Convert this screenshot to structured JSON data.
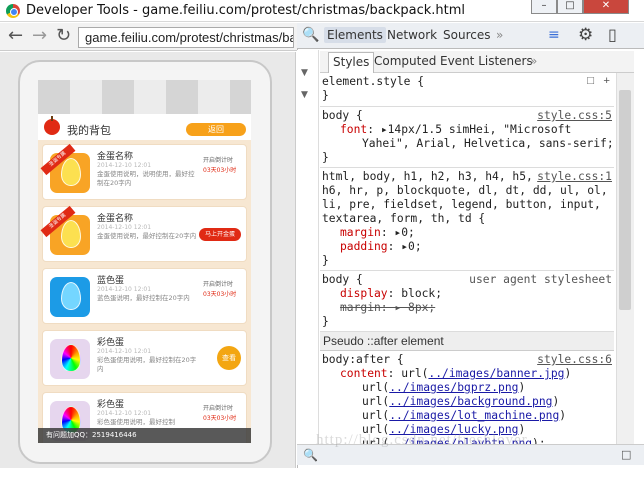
{
  "window": {
    "title": "Developer Tools - game.feiliu.com/protest/christmas/backpack.html",
    "controls": {
      "minimize": "–",
      "maximize": "□",
      "close": "✕"
    }
  },
  "nav": {
    "back": "←",
    "forward": "→",
    "reload": "↻",
    "url": "game.feiliu.com/protest/christmas/back"
  },
  "page": {
    "header_title": "我的背包",
    "back_button": "返回",
    "items": [
      {
        "name": "金蛋名称",
        "date": "2014-12-10 12:01",
        "desc": "金蛋使用说明，说明使用，最好控制在20字内",
        "ribbon": "圣诞专属",
        "countdown_label": "开启倒计时",
        "countdown": "03天03小时",
        "egg": "gold"
      },
      {
        "name": "金蛋名称",
        "date": "2014-12-10 12:01",
        "desc": "金蛋使用说明，最好控制在20字内",
        "ribbon": "圣诞专属",
        "action": "马上开金蛋",
        "egg": "gold"
      },
      {
        "name": "蓝色蛋",
        "date": "2014-12-10 12:01",
        "desc": "蓝色蛋说明，最好控制在20字内",
        "countdown_label": "开启倒计时",
        "countdown": "03天03小时",
        "egg": "blue"
      },
      {
        "name": "彩色蛋",
        "date": "2014-12-10 12:01",
        "desc": "彩色蛋使用说明，最好控制在20字内",
        "action": "查看",
        "egg": "rainbow"
      },
      {
        "name": "彩色蛋",
        "date": "2014-12-10 12:01",
        "desc": "彩色蛋使用说明，最好控制",
        "countdown_label": "开启倒计时",
        "countdown": "03天03小时",
        "egg": "rainbow"
      }
    ],
    "footer": "有问题加QQ：2519416446"
  },
  "devtools": {
    "tabs": [
      "Elements",
      "Network",
      "Sources"
    ],
    "more": "»",
    "subtabs": [
      "Styles",
      "Computed",
      "Event Listeners"
    ],
    "rules": {
      "element_style": "element.style {",
      "body_selector": "body {",
      "body_src": "style.css:5",
      "font_prop": "font",
      "font_val": "14px/1.5 simHei, \"Microsoft",
      "font_val2": "Yahei\", Arial, Helvetica, sans-serif;",
      "reset_src": "style.css:1",
      "reset_selector1": "html, body, h1, h2, h3, h4, h5,",
      "reset_selector2": "h6, hr, p, blockquote, dl, dt, dd, ul, ol,",
      "reset_selector3": "li, pre, fieldset, legend, button, input,",
      "reset_selector4": "textarea, form, th, td {",
      "margin_prop": "margin",
      "margin_val": "0;",
      "padding_prop": "padding",
      "padding_val": "0;",
      "ua_selector": "body {",
      "ua_src": "user agent stylesheet",
      "display_prop": "display",
      "display_val": "block;",
      "ua_margin": "margin: ▸ 8px;",
      "pseudo_header": "Pseudo ::after element",
      "after_selector": "body:after {",
      "after_src": "style.css:6",
      "content_prop": "content",
      "content_urls": [
        "../images/banner.jpg",
        "../images/bgprz.png",
        "../images/background.png",
        "../images/lot_machine.png",
        "../images/lucky.png",
        "../images/playbtn.png"
      ],
      "close_brace": "}"
    }
  },
  "watermark": "http://blog.csdn.net/freshlover"
}
